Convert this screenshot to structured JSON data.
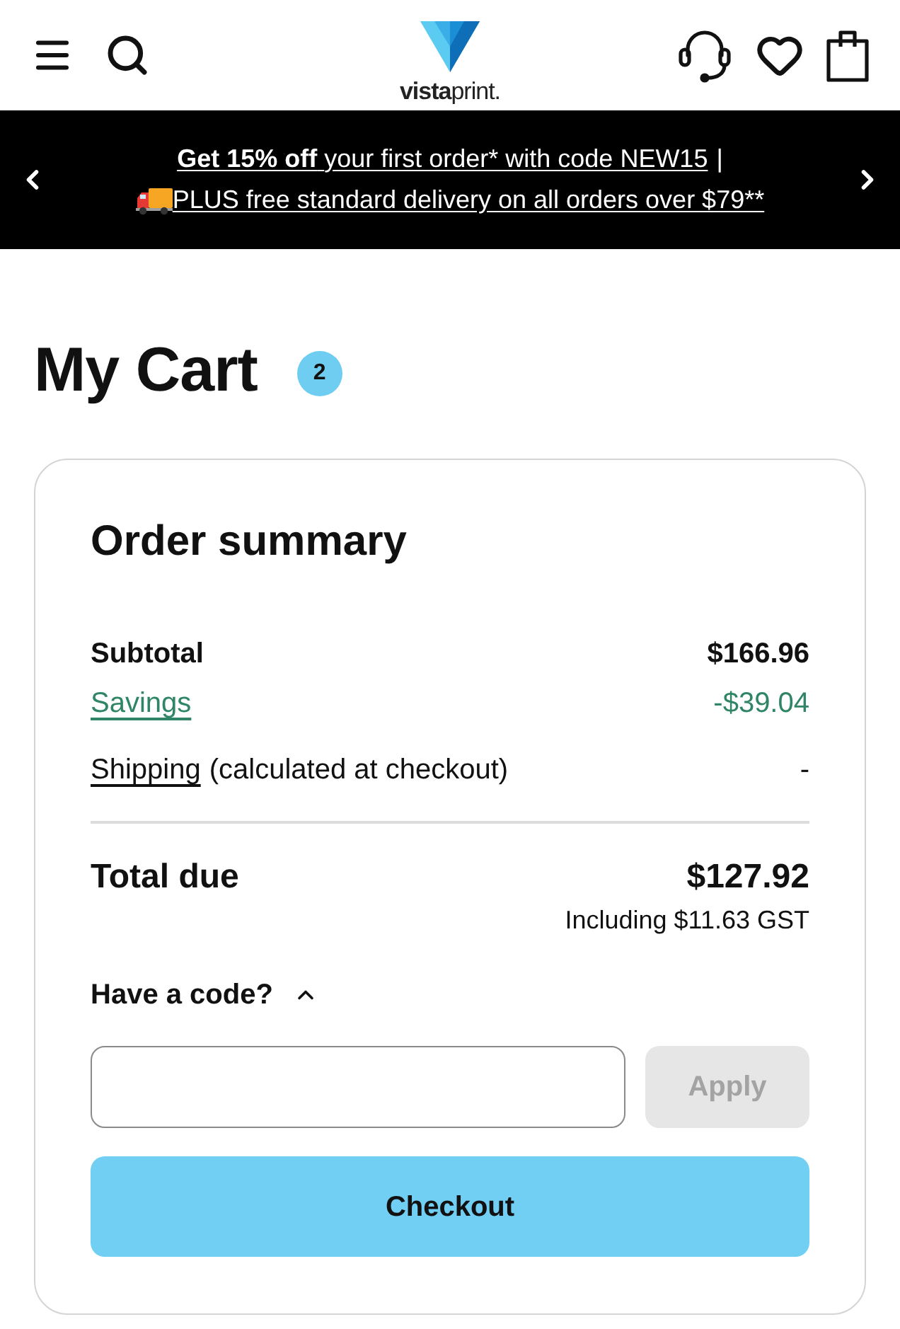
{
  "header": {
    "logo": "**vista**print."
  },
  "promo_banner": {
    "offer_bold": "Get 15% off",
    "offer_rest": "your first order* with code NEW15",
    "separator": "|",
    "delivery": "PLUS free standard delivery on all orders over $79**"
  },
  "cart": {
    "title": "My Cart",
    "item_count": "2"
  },
  "order_summary": {
    "title": "Order summary",
    "lines": [
      {
        "kind": "plain",
        "label": "Subtotal",
        "value": "$166.96"
      },
      {
        "kind": "savings",
        "label": "Savings",
        "value": "-$39.04"
      },
      {
        "kind": "shipping",
        "label": "Shipping",
        "note": "(calculated at checkout)",
        "value": "-"
      }
    ],
    "total": {
      "label": "Total due",
      "value": "$127.92",
      "tax_note": "Including $11.63 GST"
    },
    "promo_code": {
      "label": "Have a code?",
      "expanded": true,
      "apply_button": {
        "label": "Apply",
        "disabled": true
      }
    },
    "checkout_button": "Checkout"
  }
}
